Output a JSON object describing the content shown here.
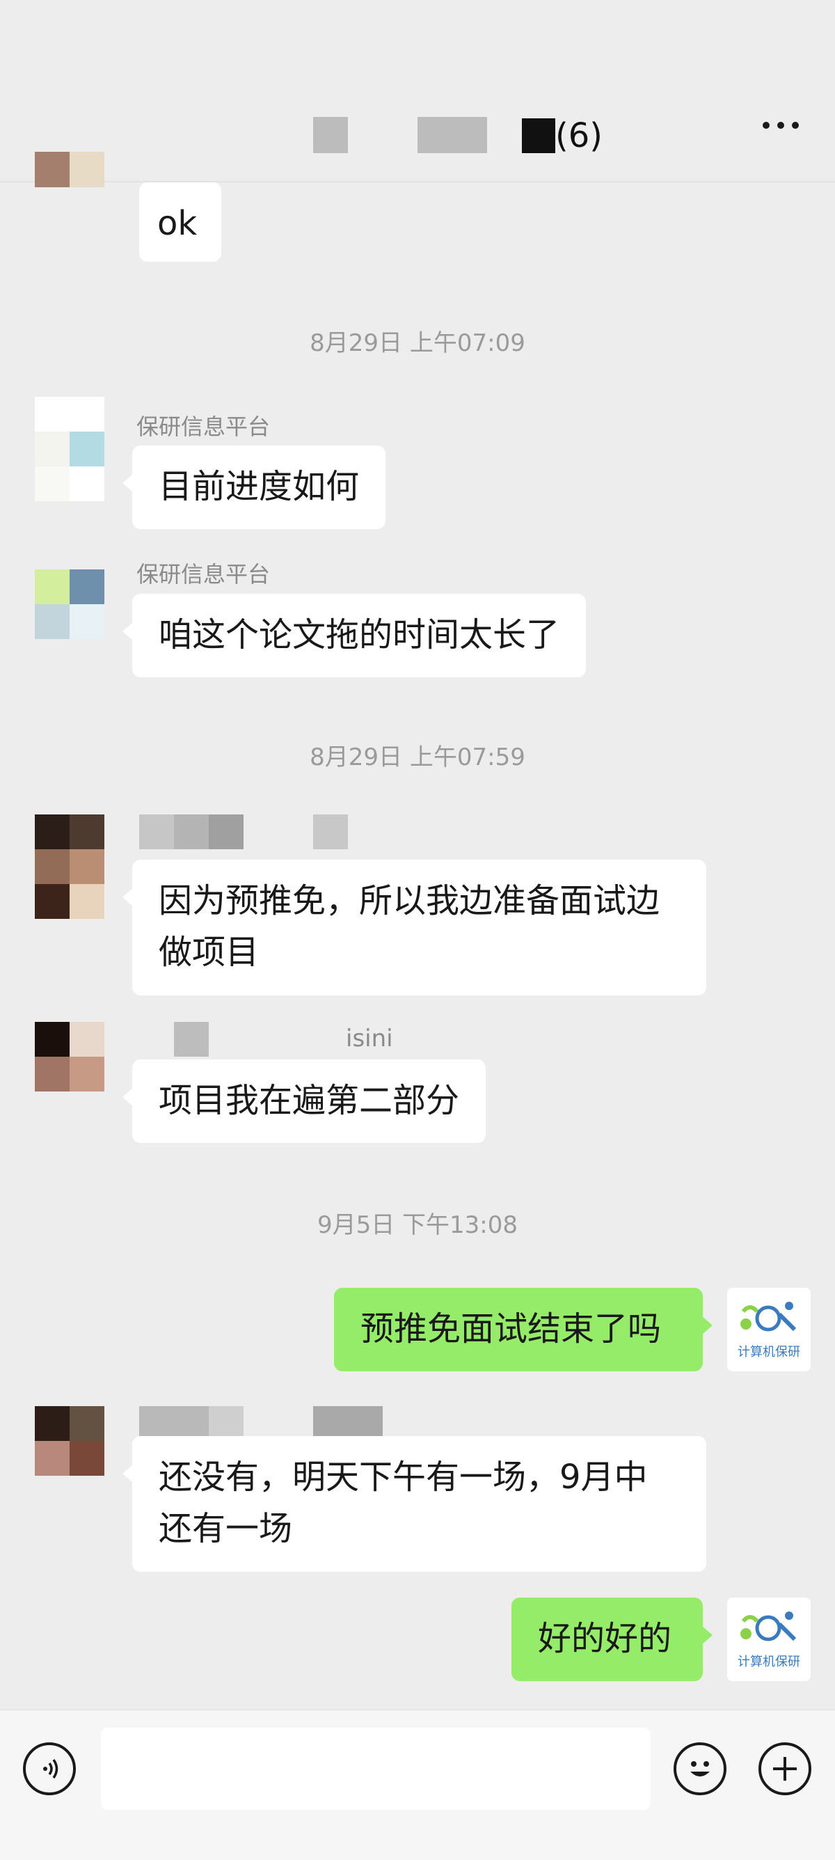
{
  "header": {
    "title_suffix": "字(6)"
  },
  "messages": {
    "m0": {
      "text": "ok"
    },
    "t1": "8月29日 上午07:09",
    "m1": {
      "name": "保研信息平台",
      "text": "目前进度如何"
    },
    "m2": {
      "name": "保研信息平台",
      "text": "咱这个论文拖的时间太长了"
    },
    "t2": "8月29日 上午07:59",
    "m3": {
      "text": "因为预推免，所以我边准备面试边做项目"
    },
    "m4": {
      "name_fragment": "isini",
      "text": "项目我在遍第二部分"
    },
    "t3": "9月5日 下午13:08",
    "m5": {
      "text": "预推免面试结束了吗"
    },
    "m6": {
      "text": "还没有，明天下午有一场，9月中还有一场"
    },
    "m7": {
      "text": "好的好的"
    }
  },
  "self_avatar": {
    "label": "计算机保研"
  },
  "icons": {
    "voice": "voice-icon",
    "emoji": "emoji-icon",
    "plus": "plus-icon",
    "more": "more-icon"
  },
  "colors": {
    "background": "#ededed",
    "self_bubble": "#95ec69",
    "other_bubble": "#ffffff"
  }
}
